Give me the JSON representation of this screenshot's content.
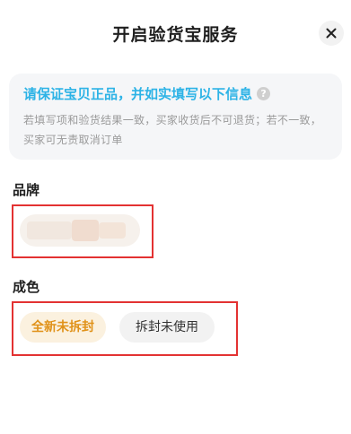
{
  "header": {
    "title": "开启验货宝服务",
    "close_icon": "close-icon"
  },
  "notice": {
    "title": "请保证宝贝正品，并如实填写以下信息",
    "help_icon": "question-circle-icon",
    "help_glyph": "?",
    "description": "若填写项和验货结果一致，买家收货后不可退货；若不一致，买家可无责取消订单",
    "title_color": "#2db3e6"
  },
  "brand": {
    "label": "品牌",
    "value_state": "blurred"
  },
  "condition": {
    "label": "成色",
    "options": [
      {
        "label": "全新未拆封",
        "selected": true
      },
      {
        "label": "拆封未使用",
        "selected": false
      }
    ],
    "selected_color": "#e0921a"
  },
  "colors": {
    "highlight_border": "#e33232",
    "accent": "#2db3e6"
  }
}
